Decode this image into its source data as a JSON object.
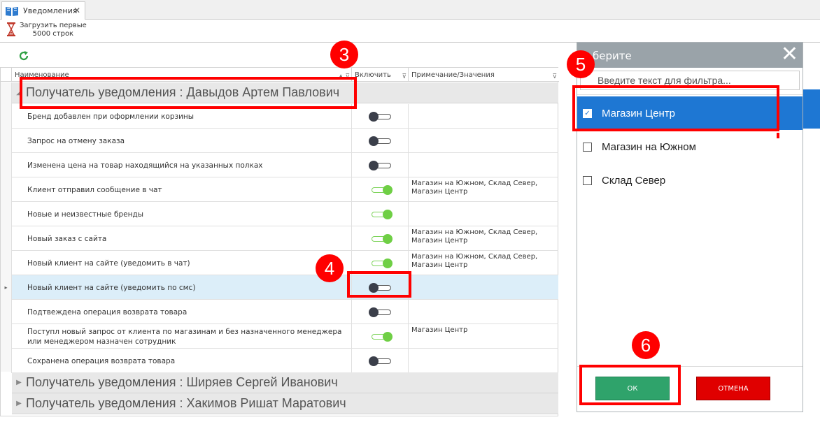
{
  "tab": {
    "title": "Уведомления",
    "close": "✕"
  },
  "toolbar": {
    "load_label_line1": "Загрузить первые",
    "load_label_line2": "5000 строк"
  },
  "grid": {
    "columns": [
      "Наименование",
      "Включить",
      "Примечание/Значения"
    ],
    "groups": [
      "Получатель уведомления : Давыдов Артем Павлович",
      "Получатель уведомления : Ширяев Сергей Иванович",
      "Получатель уведомления : Хакимов Ришат Маратович"
    ],
    "rows": [
      {
        "name": "Бренд добавлен при оформлении корзины",
        "enabled": false,
        "note": ""
      },
      {
        "name": "Запрос на отмену заказа",
        "enabled": false,
        "note": ""
      },
      {
        "name": "Изменена цена на товар находящийся на указанных полках",
        "enabled": false,
        "note": ""
      },
      {
        "name": "Клиент отправил сообщение в чат",
        "enabled": true,
        "note": " Магазин на Южном, Склад Север, Магазин Центр"
      },
      {
        "name": "Новые и неизвестные бренды",
        "enabled": true,
        "note": ""
      },
      {
        "name": "Новый заказ с сайта",
        "enabled": true,
        "note": " Магазин на Южном, Склад Север, Магазин Центр"
      },
      {
        "name": "Новый клиент на сайте (уведомить в чат)",
        "enabled": true,
        "note": " Магазин на Южном, Склад Север, Магазин Центр"
      },
      {
        "name": "Новый клиент на сайте (уведомить по смс)",
        "enabled": false,
        "note": ""
      },
      {
        "name": "Подтвеждена операция возврата товара",
        "enabled": false,
        "note": ""
      },
      {
        "name": "Поступл новый запрос от клиента по магазинам и без назначенного менеджера или менеджером назначен сотрудник",
        "enabled": true,
        "note": " Магазин Центр"
      },
      {
        "name": "Сохранена операция возврата товара",
        "enabled": false,
        "note": ""
      }
    ]
  },
  "popup": {
    "title": "берите",
    "close": "✕",
    "filter_placeholder": "Введите текст для фильтра...",
    "options": [
      {
        "label": "Магазин Центр",
        "checked": true
      },
      {
        "label": "Магазин на Южном",
        "checked": false
      },
      {
        "label": "Склад Север",
        "checked": false
      }
    ],
    "ok_label": "ОК",
    "cancel_label": "ОТМЕНА"
  },
  "annotations": {
    "badges": [
      "3",
      "4",
      "5",
      "6"
    ]
  },
  "colors": {
    "accent_blue": "#1e77d3",
    "ok_green": "#2fa36b",
    "cancel_red": "#e00000",
    "annotation_red": "#ff0000"
  }
}
